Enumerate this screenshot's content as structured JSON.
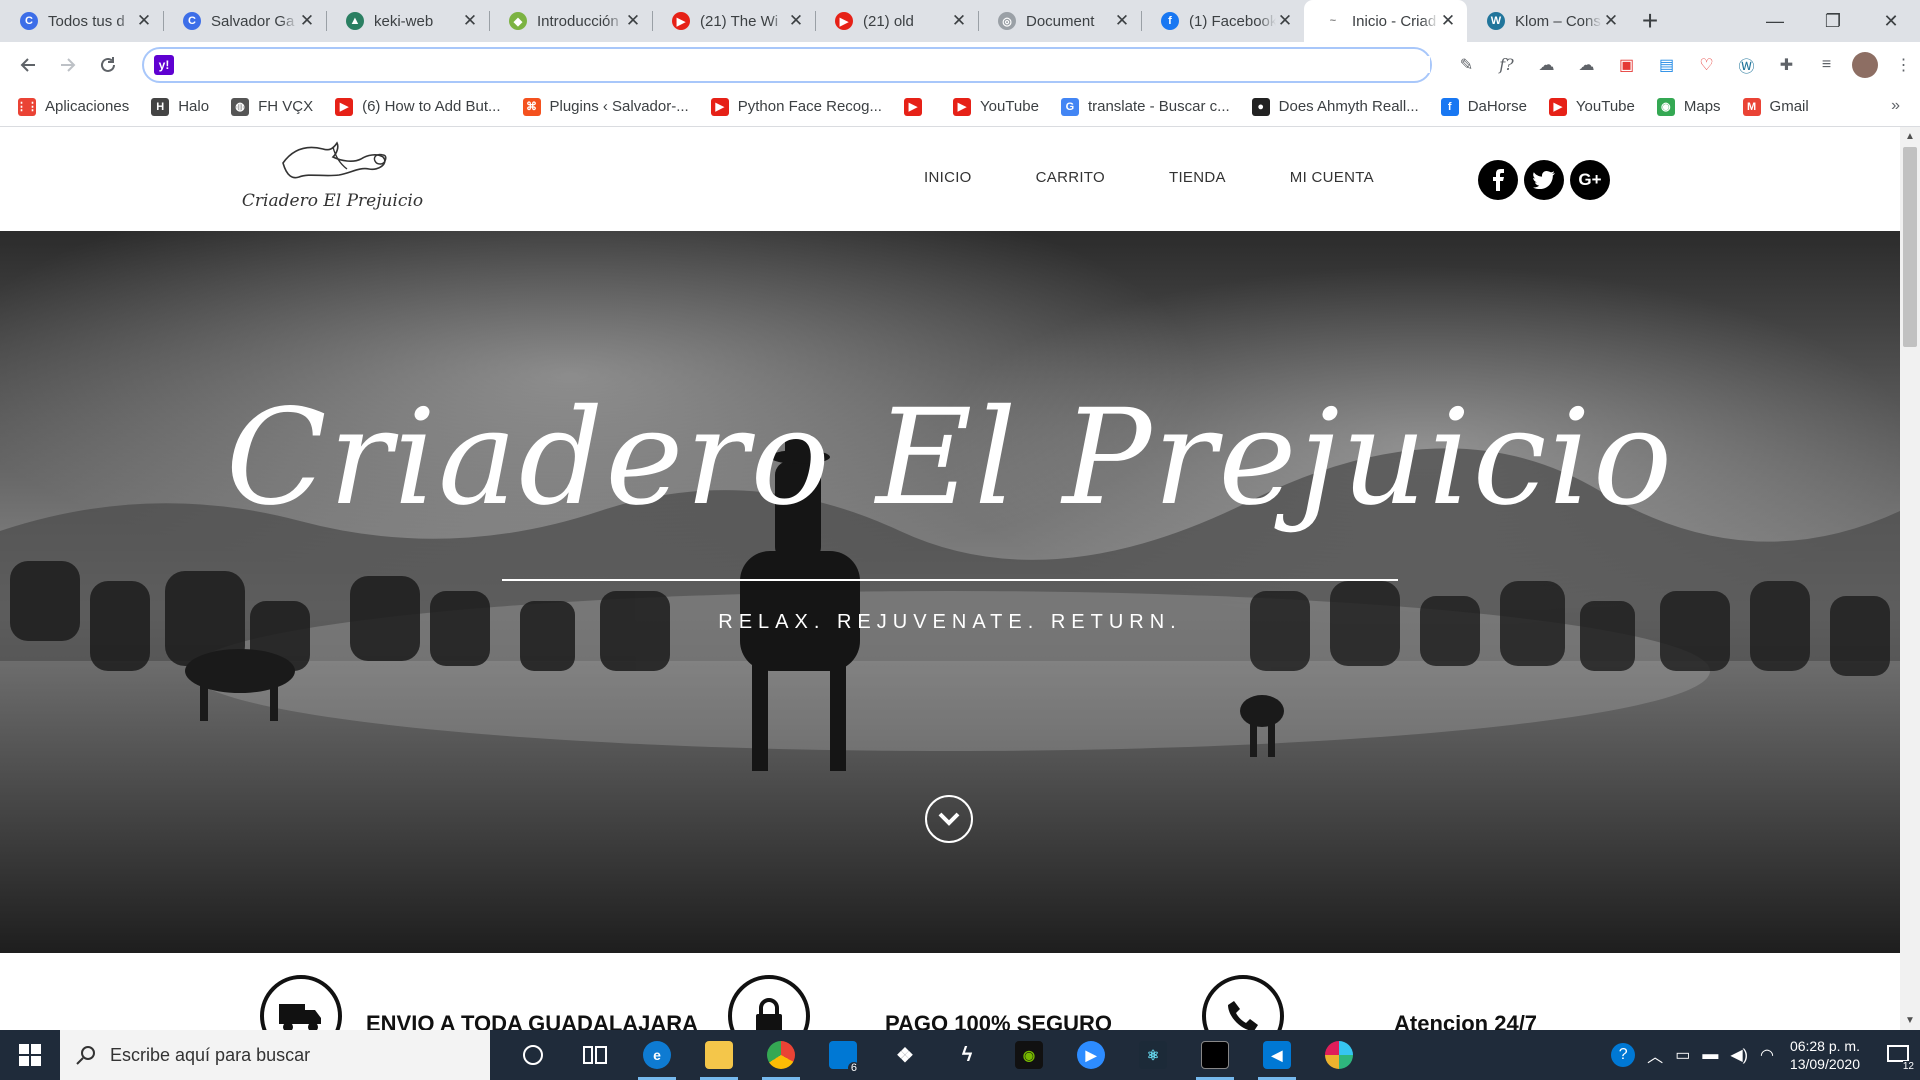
{
  "browser": {
    "tabs": [
      {
        "title": "Todos tus d",
        "fav_color": "#3d6ee8",
        "fav_glyph": "C"
      },
      {
        "title": "Salvador Ga",
        "fav_color": "#3d6ee8",
        "fav_glyph": "C"
      },
      {
        "title": "keki-web",
        "fav_color": "#2a7f62",
        "fav_glyph": "▲"
      },
      {
        "title": "Introducción",
        "fav_color": "#7cb342",
        "fav_glyph": "◆"
      },
      {
        "title": "(21) The Wi",
        "fav_color": "#e62117",
        "fav_glyph": "▶"
      },
      {
        "title": "(21) old",
        "fav_color": "#e62117",
        "fav_glyph": "▶"
      },
      {
        "title": "Document",
        "fav_color": "#9aa0a6",
        "fav_glyph": "◎"
      },
      {
        "title": "(1) Facebook",
        "fav_color": "#1877f2",
        "fav_glyph": "f"
      },
      {
        "title": "Inicio - Criad",
        "fav_color": "#ffffff",
        "fav_glyph": "~",
        "active": true
      },
      {
        "title": "Klom – Cons",
        "fav_color": "#21759b",
        "fav_glyph": "W"
      }
    ],
    "new_tab_glyph": "+",
    "close_glyph": "✕",
    "window": {
      "minimize": "—",
      "restore": "❐",
      "close": "✕"
    },
    "address_value": "",
    "bookmarks": [
      {
        "label": "Aplicaciones",
        "color": "#ea4335",
        "glyph": "⋮⋮"
      },
      {
        "label": "Halo",
        "color": "#444",
        "glyph": "H"
      },
      {
        "label": "FH VÇX",
        "color": "#555",
        "glyph": "◍"
      },
      {
        "label": "(6) How to Add But...",
        "color": "#e62117",
        "glyph": "▶"
      },
      {
        "label": "Plugins ‹ Salvador-...",
        "color": "#f4511e",
        "glyph": "⌘"
      },
      {
        "label": "Python Face Recog...",
        "color": "#e62117",
        "glyph": "▶"
      },
      {
        "label": "",
        "color": "#e62117",
        "glyph": "▶"
      },
      {
        "label": "YouTube",
        "color": "#e62117",
        "glyph": "▶"
      },
      {
        "label": "translate - Buscar c...",
        "color": "#4285f4",
        "glyph": "G"
      },
      {
        "label": "Does Ahmyth Reall...",
        "color": "#222",
        "glyph": "●"
      },
      {
        "label": "DaHorse",
        "color": "#1877f2",
        "glyph": "f"
      },
      {
        "label": "YouTube",
        "color": "#e62117",
        "glyph": "▶"
      },
      {
        "label": "Maps",
        "color": "#34a853",
        "glyph": "◉"
      },
      {
        "label": "Gmail",
        "color": "#ea4335",
        "glyph": "M"
      }
    ],
    "bookmarks_more": "»"
  },
  "site": {
    "logo_text": "Criadero El Prejuicio",
    "menu": [
      "INICIO",
      "CARRITO",
      "TIENDA",
      "MI CUENTA"
    ],
    "social": [
      {
        "name": "facebook",
        "glyph": "f"
      },
      {
        "name": "twitter",
        "glyph": "t"
      },
      {
        "name": "google-plus",
        "glyph": "G+"
      }
    ],
    "hero": {
      "title": "Criadero El Prejuicio",
      "tagline": "RELAX. REJUVENATE. RETURN."
    },
    "features": [
      {
        "label": "ENVIO A TODA GUADALAJARA",
        "icon": "truck-icon"
      },
      {
        "label": "PAGO 100% SEGURO",
        "icon": "lock-icon"
      },
      {
        "label": "Atencion 24/7",
        "icon": "phone-icon"
      }
    ]
  },
  "taskbar": {
    "search_placeholder": "Escribe aquí para buscar",
    "mail_badge": "6",
    "time": "06:28 p. m.",
    "date": "13/09/2020",
    "notification_count": "12"
  }
}
